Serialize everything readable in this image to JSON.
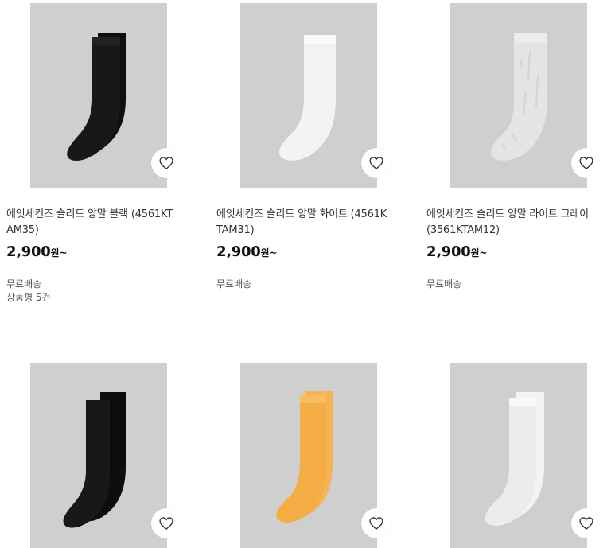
{
  "products": [
    {
      "name": "에잇세컨즈 솔리드 양말 블랙 (4561KTAM35)",
      "price": "2,900",
      "price_unit": "원~",
      "shipping": "무료배송",
      "reviews": "상품평 5건",
      "sock_color": "#111111",
      "image_bg": "#cfcfcf"
    },
    {
      "name": "에잇세컨즈 솔리드 양말 화이트 (4561KTAM31)",
      "price": "2,900",
      "price_unit": "원~",
      "shipping": "무료배송",
      "sock_color": "#f3f3f3",
      "image_bg": "#cfcfcf"
    },
    {
      "name": "에잇세컨즈 솔리드 양말 라이트 그레이 (3561KTAM12)",
      "price": "2,900",
      "price_unit": "원~",
      "shipping": "무료배송",
      "sock_color": "#e2e2e2",
      "image_bg": "#cfcfcf"
    },
    {
      "sock_color": "#141414",
      "image_bg": "#cfcfcf"
    },
    {
      "sock_color": "#f6b451",
      "image_bg": "#cfcfcf"
    },
    {
      "sock_color": "#f2f2f2",
      "image_bg": "#cfcfcf"
    }
  ],
  "icons": {
    "wishlist": "heart-outline-icon"
  }
}
